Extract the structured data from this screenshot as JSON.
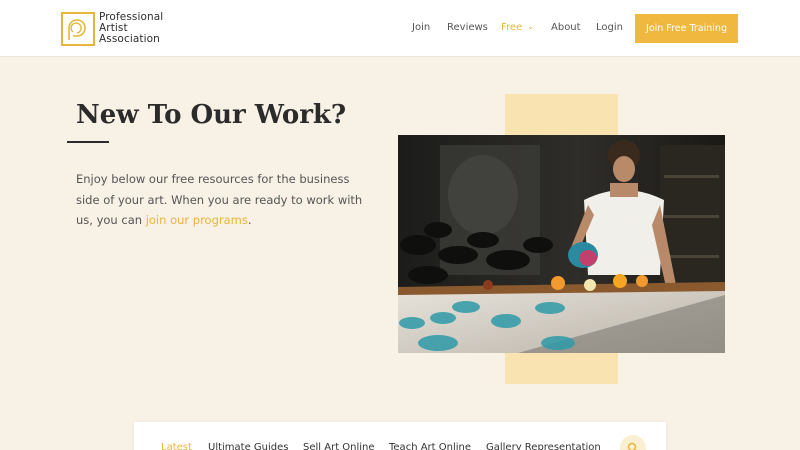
{
  "brand": {
    "line1": "Professional",
    "line2": "Artist",
    "line3": "Association",
    "accent_color": "#e5b63a"
  },
  "nav": {
    "join": "Join",
    "reviews": "Reviews",
    "free": "Free",
    "about": "About",
    "login": "Login",
    "cta": "Join Free Training"
  },
  "hero": {
    "title": "New To Our Work?",
    "text_before": "Enjoy below our free resources for the business side of your art. When you are ready to work with us, you can ",
    "link": "join our programs",
    "text_after": "."
  },
  "tabs": {
    "items": [
      "Latest",
      "Ultimate Guides",
      "Sell Art Online",
      "Teach Art Online",
      "Gallery Representation"
    ],
    "active": "Latest"
  },
  "icons": {
    "search": "search-icon",
    "free_dropdown": "chevron-down-icon",
    "logo": "logo-mark-icon"
  },
  "colors": {
    "background": "#f7f1e6",
    "cta": "#f0b83e",
    "accent_block": "#f8e3b1"
  }
}
